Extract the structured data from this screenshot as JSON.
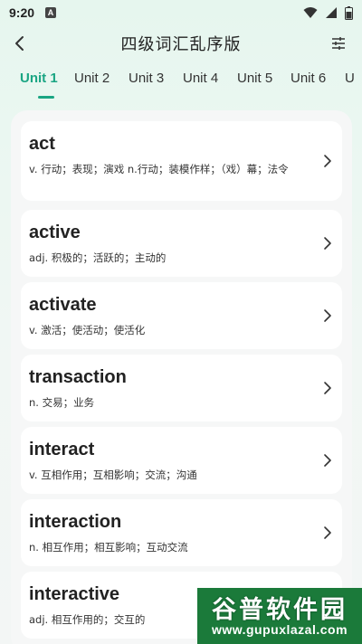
{
  "status_bar": {
    "time": "9:20",
    "notification_letter": "A"
  },
  "header": {
    "title": "四级词汇乱序版"
  },
  "tabs": [
    {
      "label": "Unit 1",
      "active": true
    },
    {
      "label": "Unit 2",
      "active": false
    },
    {
      "label": "Unit 3",
      "active": false
    },
    {
      "label": "Unit 4",
      "active": false
    },
    {
      "label": "Unit 5",
      "active": false
    },
    {
      "label": "Unit 6",
      "active": false
    },
    {
      "label": "U",
      "active": false
    }
  ],
  "words": [
    {
      "word": "act",
      "meaning": "v. 行动；表现；演戏 n.行动；装模作样；（戏）幕；法令"
    },
    {
      "word": "active",
      "meaning": "adj. 积极的；活跃的；主动的"
    },
    {
      "word": "activate",
      "meaning": "v. 激活；使活动；使活化"
    },
    {
      "word": "transaction",
      "meaning": "n. 交易；业务"
    },
    {
      "word": "interact",
      "meaning": "v. 互相作用；互相影响；交流；沟通"
    },
    {
      "word": "interaction",
      "meaning": "n. 相互作用；相互影响；互动交流"
    },
    {
      "word": "interactive",
      "meaning": "adj. 相互作用的；交互的"
    }
  ],
  "watermark": {
    "top": "谷普软件园",
    "bottom": "www.gupuxlazal.com"
  },
  "colors": {
    "accent": "#1aa583",
    "watermark_bg": "#1b7a3a"
  }
}
